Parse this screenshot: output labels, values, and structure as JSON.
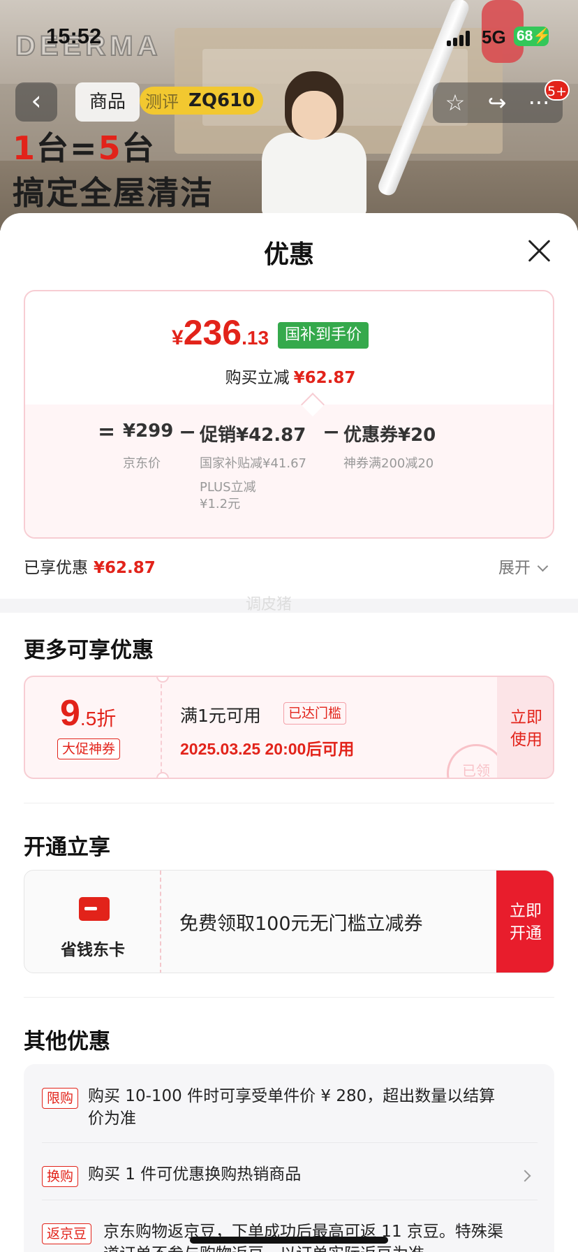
{
  "status_bar": {
    "time": "15:52",
    "network": "5G",
    "battery": "68"
  },
  "hero": {
    "brand": "DEERMA",
    "headline_1_part_a": "1",
    "headline_1_part_b": "台=",
    "headline_1_part_c": "5",
    "headline_1_part_d": "台",
    "headline_2": "搞定全屋清洁",
    "model_chip": "ZQ610"
  },
  "nav": {
    "back_icon": "chevron-left-icon",
    "tab_goods": "商品",
    "tab_review": "测评",
    "badge": "5+"
  },
  "sheet": {
    "title": "优惠",
    "price": {
      "currency": "¥",
      "integer": "236",
      "decimal": ".13"
    },
    "gov_tag": "国补到手价",
    "reduce_label": "购买立减",
    "reduce_amount": "¥62.87",
    "calc": {
      "eq": "=",
      "jd_price": "¥299",
      "jd_price_label": "京东价",
      "minus1": "−",
      "promo": "促销¥42.87",
      "promo_sub1": "国家补贴减¥41.67",
      "promo_sub2": "PLUS立减",
      "promo_sub3": "¥1.2元",
      "minus2": "−",
      "coupon": "优惠券¥20",
      "coupon_sub": "神券满200减20"
    },
    "enjoyed_label": "已享优惠",
    "enjoyed_amount": "¥62.87",
    "expand_label": "展开",
    "watermark": "调皮猪"
  },
  "more": {
    "title": "更多可享优惠",
    "coupon": {
      "discount_int": "9",
      "discount_rest": ".5折",
      "tag": "大促神券",
      "condition": "满1元可用",
      "reached": "已达门槛",
      "time": "2025.03.25 20:00后可用",
      "use_1": "立即",
      "use_2": "使用",
      "stamp": "已领"
    }
  },
  "open": {
    "title": "开通立享",
    "card_name": "省钱东卡",
    "desc": "免费领取100元无门槛立减券",
    "btn_1": "立即",
    "btn_2": "开通"
  },
  "other": {
    "title": "其他优惠",
    "rows": [
      {
        "tag": "限购",
        "line1": "购买 10-100 件时可享受单件价 ¥ 280，超出数量以结算",
        "line2": "价为准"
      },
      {
        "tag": "换购",
        "line1": "购买 1 件可优惠换购热销商品"
      },
      {
        "tag": "返京豆",
        "line1": "京东购物返京豆，下单成功后最高可返 11 京豆。特殊渠",
        "line2": "道订单不参与购物返豆，以订单实际返豆为准"
      }
    ]
  }
}
